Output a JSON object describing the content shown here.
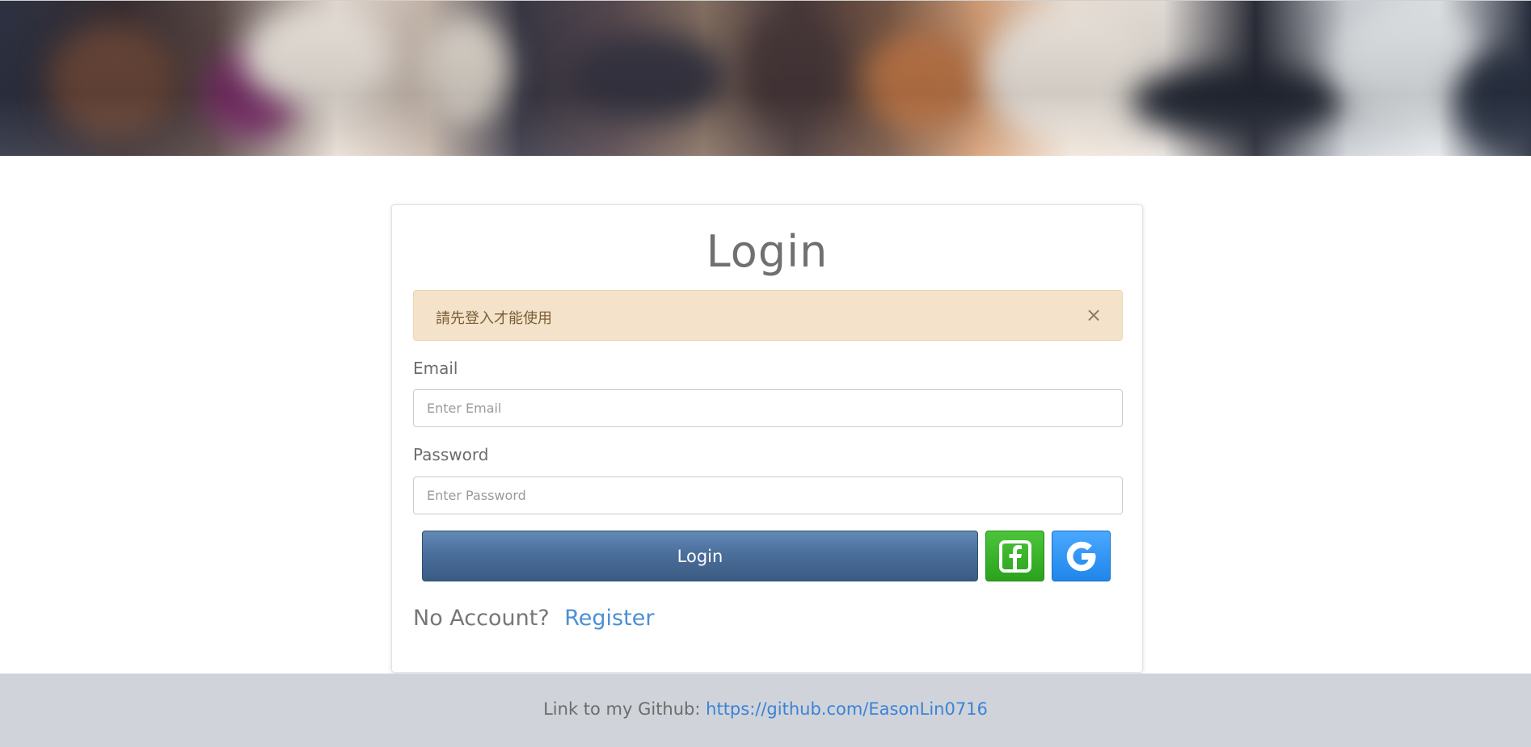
{
  "banner": {
    "description_icon": "banner-image"
  },
  "card": {
    "title": "Login",
    "alert": {
      "message": "請先登入才能使用",
      "close_label": "×"
    },
    "email": {
      "label": "Email",
      "placeholder": "Enter Email",
      "value": ""
    },
    "password": {
      "label": "Password",
      "placeholder": "Enter Password",
      "value": ""
    },
    "login_button": "Login",
    "facebook_icon": "facebook-icon",
    "google_icon": "google-icon",
    "no_account_text": "No Account?",
    "register_link": "Register"
  },
  "footer": {
    "text": "Link to my Github:",
    "link": "https://github.com/EasonLin0716"
  },
  "colors": {
    "alert_bg": "#f4e3ca",
    "login_button": "#4b6f9b",
    "facebook_button": "#2aa21c",
    "google_button": "#1f86ea",
    "link": "#4a8fd6",
    "footer_bg": "#d0d4da"
  }
}
